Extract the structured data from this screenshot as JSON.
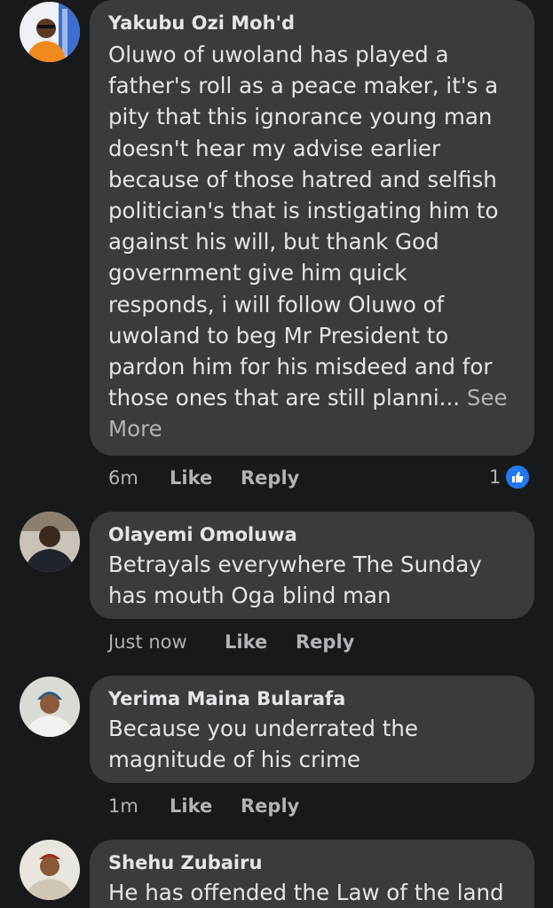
{
  "comments": [
    {
      "author": "Yakubu Ozi Moh'd",
      "text": "Oluwo of uwoland has played a\nfather's roll as a peace maker, it's a\npity that this ignorance young man\ndoesn't hear my advise earlier\nbecause of those hatred and selfish\npolitician's that is instigating him to\nagainst his will, but thank God\ngovernment give him quick\nresponds, i will follow Oluwo of\nuwoland to beg Mr President to\npardon him for his misdeed and for\nthose ones that are still planni...",
      "see_more": " See\nMore",
      "time": "6m",
      "like_label": "Like",
      "reply_label": "Reply",
      "reaction_count": "1"
    },
    {
      "author": "Olayemi Omoluwa",
      "text": "Betrayals everywhere The Sunday\nhas mouth Oga blind man",
      "time": "Just now",
      "like_label": "Like",
      "reply_label": "Reply"
    },
    {
      "author": "Yerima Maina Bularafa",
      "text": "Because you underrated the\nmagnitude of his crime",
      "time": "1m",
      "like_label": "Like",
      "reply_label": "Reply"
    },
    {
      "author": "Shehu Zubairu",
      "text": "He has offended the Law of the land"
    }
  ],
  "colors": {
    "background": "#18191a",
    "bubble": "#3a3b3c",
    "primary_text": "#e4e6eb",
    "secondary_text": "#b0b3b8",
    "like_blue": "#2078f4"
  },
  "icons": {
    "reaction": "thumbs-up-icon"
  }
}
